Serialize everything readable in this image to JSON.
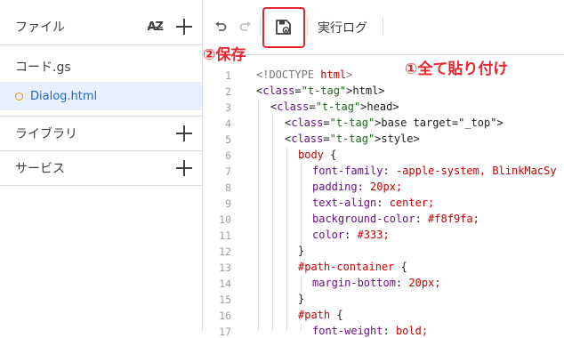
{
  "sidebar": {
    "files_header": "ファイル",
    "sort_label": "AZ",
    "files": [
      {
        "name": "コード.gs",
        "selected": false
      },
      {
        "name": "Dialog.html",
        "selected": true
      }
    ],
    "libraries_label": "ライブラリ",
    "services_label": "サービス"
  },
  "toolbar": {
    "undo_icon": "undo-icon",
    "redo_icon": "redo-icon",
    "save_icon": "save-icon",
    "run_log_label": "実行ログ"
  },
  "annotations": {
    "step1": "①全て貼り付け",
    "step2": "②保存",
    "color": "#e8262e"
  },
  "editor": {
    "lines": [
      {
        "n": "1",
        "code": "<!DOCTYPE html>"
      },
      {
        "n": "2",
        "code": "<html>"
      },
      {
        "n": "3",
        "code": "<head>"
      },
      {
        "n": "4",
        "code": "<base target=\"_top\">"
      },
      {
        "n": "5",
        "code": "<style>"
      },
      {
        "n": "6",
        "code": "body {"
      },
      {
        "n": "7",
        "code": "font-family: -apple-system, BlinkMacSy"
      },
      {
        "n": "8",
        "code": "padding: 20px;"
      },
      {
        "n": "9",
        "code": "text-align: center;"
      },
      {
        "n": "10",
        "code": "background-color: #f8f9fa;"
      },
      {
        "n": "11",
        "code": "color: #333;"
      },
      {
        "n": "12",
        "code": "}"
      },
      {
        "n": "13",
        "code": "#path-container {"
      },
      {
        "n": "14",
        "code": "margin-bottom: 20px;"
      },
      {
        "n": "15",
        "code": "}"
      },
      {
        "n": "16",
        "code": "#path {"
      },
      {
        "n": "17",
        "code": "font-weight: bold;"
      }
    ]
  }
}
